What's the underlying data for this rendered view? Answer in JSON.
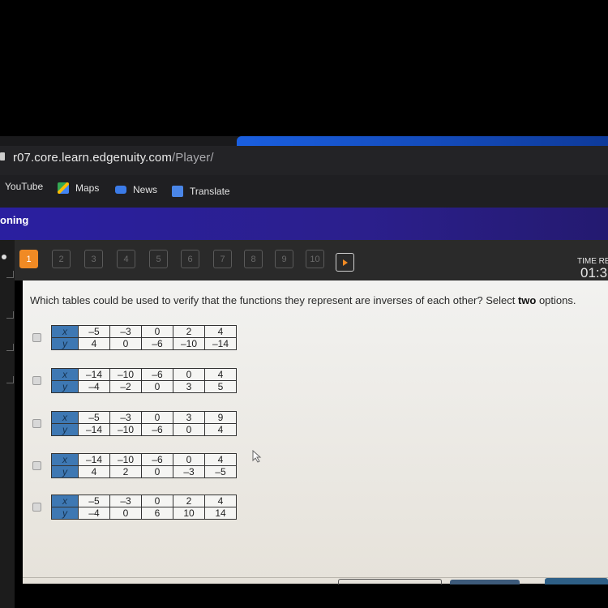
{
  "browser": {
    "url_host": "r07.core.learn.edgenuity.com",
    "url_path": "/Player/",
    "bookmarks": [
      {
        "label": "YouTube",
        "icon": "youtube-icon"
      },
      {
        "label": "Maps",
        "icon": "maps-icon"
      },
      {
        "label": "News",
        "icon": "news-icon"
      },
      {
        "label": "Translate",
        "icon": "translate-icon"
      }
    ]
  },
  "course": {
    "title": "oning"
  },
  "question_nav": {
    "items": [
      "1",
      "2",
      "3",
      "4",
      "5",
      "6",
      "7",
      "8",
      "9",
      "10"
    ],
    "current": "1",
    "next_icon": "play-arrow-icon"
  },
  "timer": {
    "label": "TIME RE",
    "value": "01:3"
  },
  "question": {
    "text_before": "Which tables could be used to verify that the functions they represent are inverses of each other? Select ",
    "text_bold": "two",
    "text_after": " options."
  },
  "options": [
    {
      "x_label": "x",
      "y_label": "y",
      "x": [
        "–5",
        "–3",
        "0",
        "2",
        "4"
      ],
      "y": [
        "4",
        "0",
        "–6",
        "–10",
        "–14"
      ]
    },
    {
      "x_label": "x",
      "y_label": "y",
      "x": [
        "–14",
        "–10",
        "–6",
        "0",
        "4"
      ],
      "y": [
        "–4",
        "–2",
        "0",
        "3",
        "5"
      ]
    },
    {
      "x_label": "x",
      "y_label": "y",
      "x": [
        "–5",
        "–3",
        "0",
        "3",
        "9"
      ],
      "y": [
        "–14",
        "–10",
        "–6",
        "0",
        "4"
      ]
    },
    {
      "x_label": "x",
      "y_label": "y",
      "x": [
        "–14",
        "–10",
        "–6",
        "0",
        "4"
      ],
      "y": [
        "4",
        "2",
        "0",
        "–3",
        "–5"
      ]
    },
    {
      "x_label": "x",
      "y_label": "y",
      "x": [
        "–5",
        "–3",
        "0",
        "2",
        "4"
      ],
      "y": [
        "–4",
        "0",
        "6",
        "10",
        "14"
      ]
    }
  ]
}
